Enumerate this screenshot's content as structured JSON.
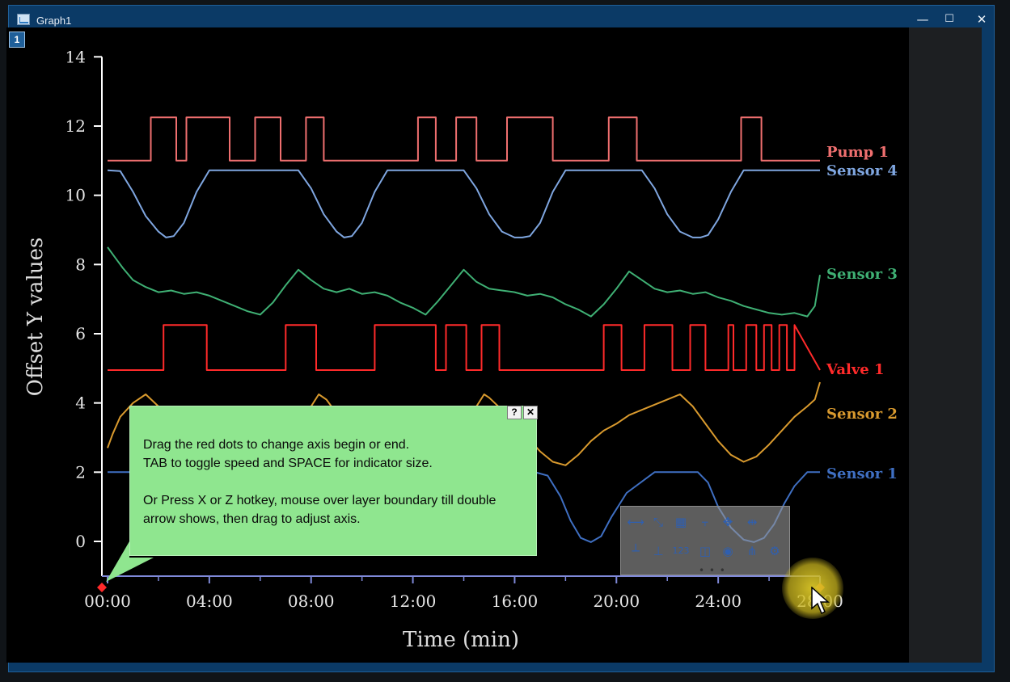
{
  "window": {
    "title": "Graph1",
    "minimize_glyph": "—",
    "maximize_glyph": "☐",
    "close_glyph": "✕"
  },
  "layer_badge": "1",
  "tooltip": {
    "help_glyph": "?",
    "close_glyph": "✕",
    "lines": [
      "Drag the red dots to change axis begin or end.",
      "TAB to toggle speed and SPACE for indicator size.",
      "",
      "Or Press X or Z hotkey, mouse over layer boundary till double",
      "arrow shows, then drag to adjust axis."
    ]
  },
  "toolbar": {
    "icons": [
      "x-axis-scale-icon",
      "xy-scale-icon",
      "grid-icon",
      "axis-break-icon",
      "y-axis-move-icon",
      "x-axis-move-icon",
      "x-ticks-icon",
      "minor-ticks-icon",
      "tick-labels-icon",
      "panel-icon",
      "visibility-icon",
      "arrange-icon",
      "settings-icon"
    ],
    "more_glyph": "• • •"
  },
  "colors": {
    "pump1": "#ef6f6f",
    "sensor4": "#7fa6e0",
    "sensor3": "#3fb074",
    "valve1": "#ff2a2a",
    "sensor2": "#d99a2e",
    "sensor1": "#3f6fc2",
    "axis": "#ffffff",
    "xaxis": "#7f89d9",
    "tooltip_bg": "#8fe68f",
    "toolbar_icon": "#2f5fb0"
  },
  "chart_data": {
    "type": "line",
    "xlabel": "Time (min)",
    "ylabel": "Offset Y values",
    "x_tick_labels": [
      "00:00",
      "04:00",
      "08:00",
      "12:00",
      "16:00",
      "20:00",
      "24:00",
      "28:00"
    ],
    "x_ticks": [
      0,
      4,
      8,
      12,
      16,
      20,
      24,
      28
    ],
    "xlim": [
      0,
      28
    ],
    "y_ticks": [
      0,
      2,
      4,
      6,
      8,
      10,
      12,
      14
    ],
    "ylim": [
      -1,
      14
    ],
    "grid": false,
    "series": [
      {
        "name": "Pump 1",
        "color_key": "pump1",
        "x": [
          0,
          1.7,
          1.7,
          2.7,
          2.7,
          3.1,
          3.1,
          4.8,
          4.8,
          5.8,
          5.8,
          6.8,
          6.8,
          7.8,
          7.8,
          8.5,
          8.5,
          12.2,
          12.2,
          12.9,
          12.9,
          13.7,
          13.7,
          14.5,
          14.5,
          15.7,
          15.7,
          17.5,
          17.5,
          19.7,
          19.7,
          20.8,
          20.8,
          24.9,
          24.9,
          25.7,
          25.7,
          28
        ],
        "y": [
          11,
          11,
          12.25,
          12.25,
          11,
          11,
          12.25,
          12.25,
          11,
          11,
          12.25,
          12.25,
          11,
          11,
          12.25,
          12.25,
          11,
          11,
          12.25,
          12.25,
          11,
          11,
          12.25,
          12.25,
          11,
          11,
          12.25,
          12.25,
          11,
          11,
          12.25,
          12.25,
          11,
          11,
          12.25,
          12.25,
          11,
          11
        ]
      },
      {
        "name": "Sensor 4",
        "color_key": "sensor4",
        "x": [
          0,
          0.5,
          1.0,
          1.5,
          2.0,
          2.3,
          2.6,
          3.0,
          3.5,
          4.0,
          5.0,
          6.0,
          7.5,
          8.0,
          8.5,
          9.0,
          9.3,
          9.6,
          10.0,
          10.5,
          11.0,
          12.0,
          13.0,
          14.0,
          14.5,
          15.0,
          15.5,
          16.0,
          16.3,
          16.6,
          17.0,
          17.5,
          18.0,
          19.0,
          21.0,
          21.5,
          22.0,
          22.5,
          23.0,
          23.3,
          23.6,
          24.0,
          24.5,
          25.0,
          26.0,
          27.0,
          28.0
        ],
        "y": [
          10.72,
          10.7,
          10.1,
          9.4,
          8.95,
          8.78,
          8.82,
          9.2,
          10.1,
          10.72,
          10.72,
          10.72,
          10.72,
          10.2,
          9.45,
          8.95,
          8.78,
          8.82,
          9.2,
          10.1,
          10.72,
          10.72,
          10.72,
          10.72,
          10.2,
          9.45,
          8.95,
          8.78,
          8.78,
          8.82,
          9.2,
          10.1,
          10.72,
          10.72,
          10.72,
          10.2,
          9.45,
          8.95,
          8.78,
          8.78,
          8.85,
          9.3,
          10.1,
          10.72,
          10.72,
          10.72,
          10.72
        ]
      },
      {
        "name": "Sensor 3",
        "color_key": "sensor3",
        "x": [
          0,
          0.3,
          0.6,
          1.0,
          1.5,
          2.0,
          2.5,
          3.0,
          3.5,
          4.0,
          4.5,
          5.0,
          5.5,
          6.0,
          6.5,
          7.0,
          7.5,
          8.0,
          8.5,
          9.0,
          9.5,
          10.0,
          10.5,
          11.0,
          11.5,
          12.0,
          12.5,
          13.0,
          13.5,
          14.0,
          14.5,
          15.0,
          15.5,
          16.0,
          16.5,
          17.0,
          17.5,
          18.0,
          18.5,
          19.0,
          19.5,
          20.0,
          20.5,
          21.0,
          21.5,
          22.0,
          22.5,
          23.0,
          23.5,
          24.0,
          24.5,
          25.0,
          25.5,
          26.0,
          26.5,
          27.0,
          27.5,
          27.8,
          28.0
        ],
        "y": [
          8.5,
          8.2,
          7.9,
          7.55,
          7.35,
          7.2,
          7.25,
          7.15,
          7.2,
          7.1,
          6.95,
          6.8,
          6.65,
          6.55,
          6.9,
          7.4,
          7.85,
          7.55,
          7.3,
          7.2,
          7.3,
          7.15,
          7.2,
          7.1,
          6.9,
          6.75,
          6.55,
          6.95,
          7.4,
          7.85,
          7.5,
          7.3,
          7.25,
          7.2,
          7.1,
          7.15,
          7.05,
          6.85,
          6.7,
          6.5,
          6.85,
          7.3,
          7.8,
          7.55,
          7.3,
          7.2,
          7.25,
          7.15,
          7.2,
          7.05,
          6.95,
          6.8,
          6.7,
          6.6,
          6.55,
          6.6,
          6.5,
          6.8,
          7.7
        ]
      },
      {
        "name": "Valve 1",
        "color_key": "valve1",
        "x": [
          0,
          2.2,
          2.2,
          3.9,
          3.9,
          7.0,
          7.0,
          8.2,
          8.2,
          10.5,
          10.5,
          12.9,
          12.9,
          13.3,
          13.3,
          14.1,
          14.1,
          14.7,
          14.7,
          15.4,
          15.4,
          16.1,
          16.1,
          19.5,
          19.5,
          20.2,
          20.2,
          21.1,
          21.1,
          22.2,
          22.2,
          22.9,
          22.9,
          23.5,
          23.5,
          24.4,
          24.4,
          24.6,
          24.6,
          25.1,
          25.1,
          25.5,
          25.5,
          25.8,
          25.8,
          26.1,
          26.1,
          26.4,
          26.4,
          26.7,
          26.7,
          27.0,
          27.0,
          28.0
        ],
        "y": [
          4.95,
          4.95,
          6.25,
          6.25,
          4.95,
          4.95,
          6.25,
          6.25,
          4.95,
          4.95,
          6.25,
          6.25,
          4.95,
          4.95,
          6.25,
          6.25,
          4.95,
          4.95,
          6.25,
          6.25,
          4.95,
          4.95,
          4.95,
          4.95,
          6.25,
          6.25,
          4.95,
          4.95,
          6.25,
          6.25,
          4.95,
          4.95,
          6.25,
          6.25,
          4.95,
          4.95,
          6.25,
          6.25,
          4.95,
          4.95,
          6.25,
          6.25,
          4.95,
          4.95,
          6.25,
          6.25,
          4.95,
          4.95,
          6.25,
          6.25,
          4.95,
          4.95,
          6.25,
          4.95
        ]
      },
      {
        "name": "Sensor 2",
        "color_key": "sensor2",
        "x": [
          0,
          0.2,
          0.5,
          1.0,
          1.5,
          2.0,
          2.5,
          3.0,
          3.5,
          4.0,
          4.5,
          5.0,
          5.5,
          6.0,
          6.5,
          7.0,
          7.5,
          8.0,
          8.3,
          8.6,
          9.0,
          9.5,
          10.0,
          10.5,
          11.0,
          11.5,
          12.0,
          12.5,
          13.0,
          13.5,
          14.0,
          14.5,
          14.8,
          15.0,
          15.5,
          16.0,
          16.5,
          17.0,
          17.5,
          18.0,
          18.5,
          19.0,
          19.5,
          20.0,
          20.5,
          21.0,
          21.5,
          22.0,
          22.5,
          23.0,
          23.5,
          24.0,
          24.5,
          25.0,
          25.5,
          26.0,
          26.5,
          27.0,
          27.5,
          27.8,
          28.0
        ],
        "y": [
          2.7,
          3.1,
          3.6,
          4.0,
          4.25,
          3.9,
          3.4,
          3.0,
          2.6,
          2.3,
          2.15,
          2.05,
          2.1,
          2.3,
          2.6,
          3.0,
          3.5,
          3.9,
          4.25,
          4.1,
          3.7,
          3.3,
          2.9,
          2.6,
          2.35,
          2.15,
          2.1,
          2.2,
          2.5,
          2.9,
          3.4,
          3.9,
          4.25,
          4.15,
          3.8,
          3.4,
          3.0,
          2.6,
          2.3,
          2.2,
          2.5,
          2.9,
          3.2,
          3.4,
          3.65,
          3.8,
          3.95,
          4.1,
          4.25,
          3.9,
          3.4,
          2.9,
          2.5,
          2.3,
          2.45,
          2.8,
          3.2,
          3.6,
          3.9,
          4.1,
          4.6
        ]
      },
      {
        "name": "Sensor 1",
        "color_key": "sensor1",
        "x": [
          0,
          0.5,
          1.0,
          2.0,
          4.0,
          6.0,
          8.0,
          10.0,
          12.0,
          14.0,
          16.0,
          16.8,
          17.3,
          17.8,
          18.2,
          18.6,
          19.0,
          19.4,
          19.8,
          20.4,
          21.5,
          23.2,
          23.6,
          24.0,
          24.5,
          25.0,
          25.4,
          25.8,
          26.2,
          26.6,
          27.0,
          27.5,
          28.0
        ],
        "y": [
          2.0,
          2.0,
          2.0,
          2.0,
          2.0,
          2.0,
          2.0,
          2.0,
          2.0,
          2.0,
          2.0,
          2.0,
          1.9,
          1.3,
          0.6,
          0.1,
          -0.02,
          0.15,
          0.7,
          1.4,
          2.0,
          2.0,
          1.7,
          1.0,
          0.4,
          0.05,
          -0.02,
          0.1,
          0.5,
          1.1,
          1.6,
          2.0,
          2.0
        ]
      }
    ],
    "legend": "right"
  }
}
